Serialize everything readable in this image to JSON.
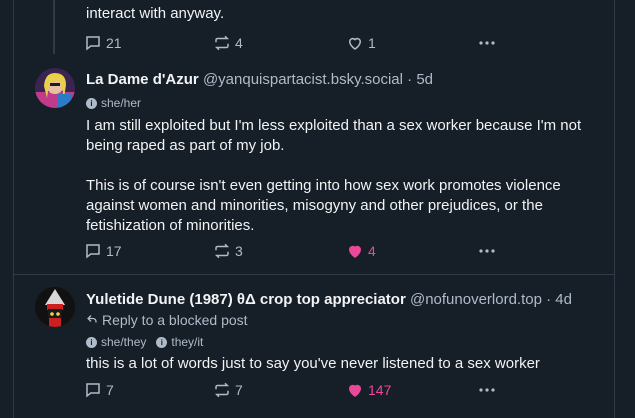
{
  "colors": {
    "background": "#161e27",
    "border": "#2e3a47",
    "text_primary": "#f1f3f5",
    "text_secondary": "#aebbc9",
    "like_active": "#ec4899"
  },
  "posts": [
    {
      "text_tail": "interact with anyway.",
      "reply_count": "21",
      "repost_count": "4",
      "like_count": "1",
      "liked": false
    },
    {
      "display_name": "La Dame d'Azur",
      "handle": "@yanquispartacist.bsky.social",
      "separator": "·",
      "time": "5d",
      "pronouns": [
        "she/her"
      ],
      "paragraphs": [
        "I am still exploited but I'm less exploited than a sex worker because I'm not being raped as part of my job.",
        "This is of course isn't even getting into how sex work promotes violence against women and minorities, misogyny and other prejudices, or the fetishization of minorities."
      ],
      "reply_count": "17",
      "repost_count": "3",
      "like_count": "4",
      "liked": true
    },
    {
      "display_name": "Yuletide Dune (1987) θΔ crop top appreciator",
      "handle": "@nofunoverlord.top",
      "separator": "·",
      "time": "4d",
      "reply_to": "Reply to a blocked post",
      "pronouns": [
        "she/they",
        "they/it"
      ],
      "paragraphs": [
        "this is a lot of words just to say you've never listened to a sex worker"
      ],
      "reply_count": "7",
      "repost_count": "7",
      "like_count": "147",
      "liked": true
    }
  ],
  "icons": {
    "reply": "reply-icon",
    "repost": "repost-icon",
    "like": "heart-icon",
    "more": "more-icon",
    "info": "info-icon",
    "reply_arrow": "reply-arrow-icon"
  }
}
